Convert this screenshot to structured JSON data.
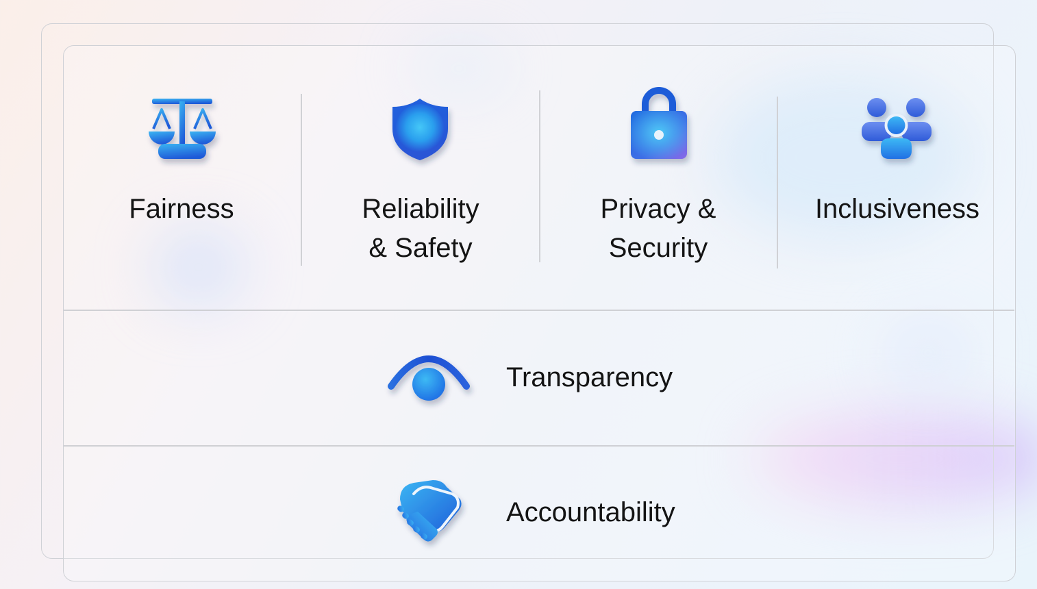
{
  "principles": [
    {
      "label": "Fairness",
      "icon": "scales-icon"
    },
    {
      "label": "Reliability\n& Safety",
      "icon": "shield-icon"
    },
    {
      "label": "Privacy &\nSecurity",
      "icon": "lock-icon"
    },
    {
      "label": "Inclusiveness",
      "icon": "people-group-icon"
    }
  ],
  "rows": [
    {
      "label": "Transparency",
      "icon": "eye-icon"
    },
    {
      "label": "Accountability",
      "icon": "handshake-icon"
    }
  ],
  "colors": {
    "icon_light": "#38b3f2",
    "icon_dark": "#1f59d8",
    "icon_violet": "#8468e8",
    "text": "#141414",
    "divider": "#cfd0d4"
  }
}
